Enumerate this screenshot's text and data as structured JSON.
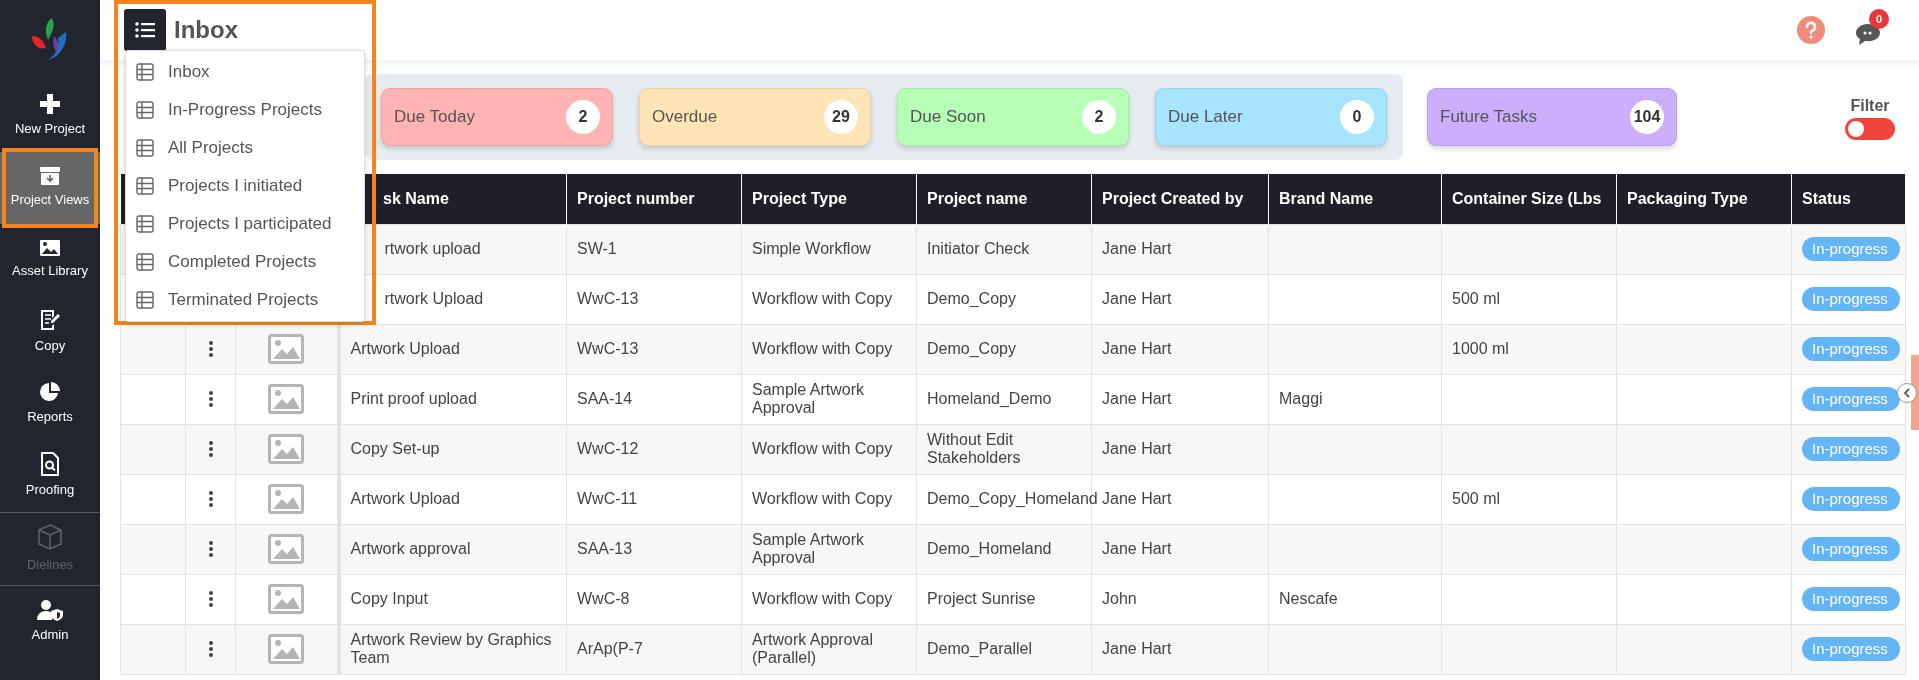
{
  "sidebar": {
    "sections": [
      {
        "items": [
          {
            "label": "New Project",
            "selected": false,
            "disabled": false,
            "highlighted": false
          },
          {
            "label": "Project Views",
            "selected": true,
            "disabled": false,
            "highlighted": true
          },
          {
            "label": "Asset Library",
            "selected": false,
            "disabled": false,
            "highlighted": false
          },
          {
            "label": "Copy",
            "selected": false,
            "disabled": false,
            "highlighted": false
          },
          {
            "label": "Reports",
            "selected": false,
            "disabled": false,
            "highlighted": false
          },
          {
            "label": "Proofing",
            "selected": false,
            "disabled": false,
            "highlighted": false
          }
        ]
      },
      {
        "items": [
          {
            "label": "Dielines",
            "selected": false,
            "disabled": true,
            "highlighted": false
          }
        ]
      },
      {
        "items": [
          {
            "label": "Admin",
            "selected": false,
            "disabled": false,
            "highlighted": false
          }
        ]
      }
    ]
  },
  "header": {
    "title": "Inbox",
    "chat_badge": "0"
  },
  "view_menu": {
    "highlighted": true,
    "items": [
      {
        "label": "Inbox"
      },
      {
        "label": "In-Progress Projects"
      },
      {
        "label": "All Projects"
      },
      {
        "label": "Projects I initiated"
      },
      {
        "label": "Projects I participated"
      },
      {
        "label": "Completed Projects"
      },
      {
        "label": "Terminated Projects"
      }
    ]
  },
  "due_cards": [
    {
      "label": "Due Today",
      "count": "2",
      "color": "#ffb3b3"
    },
    {
      "label": "Overdue",
      "count": "29",
      "color": "#ffe4b5"
    },
    {
      "label": "Due Soon",
      "count": "2",
      "color": "#b6ffb6"
    },
    {
      "label": "Due Later",
      "count": "0",
      "color": "#a6e4ff"
    }
  ],
  "future_card": {
    "label": "Future Tasks",
    "count": "104",
    "color": "#cbaefc"
  },
  "filter": {
    "label": "Filter",
    "on": false
  },
  "table": {
    "columns": [
      "sk Name",
      "Project number",
      "Project Type",
      "Project name",
      "Project Created by",
      "Brand Name",
      "Container Size (Lbs",
      "Packaging Type",
      "Status"
    ],
    "rows": [
      {
        "covered": true,
        "cells": [
          "rtwork upload",
          "SW-1",
          "Simple Workflow",
          "Initiator Check",
          "Jane Hart",
          "",
          "",
          "",
          "In-progress"
        ]
      },
      {
        "covered": true,
        "cells": [
          "rtwork Upload",
          "WwC-13",
          "Workflow with Copy",
          "Demo_Copy",
          "Jane Hart",
          "",
          "500 ml",
          "",
          "In-progress"
        ]
      },
      {
        "covered": false,
        "cells": [
          "Artwork Upload",
          "WwC-13",
          "Workflow with Copy",
          "Demo_Copy",
          "Jane Hart",
          "",
          "1000 ml",
          "",
          "In-progress"
        ]
      },
      {
        "covered": false,
        "cells": [
          "Print proof upload",
          "SAA-14",
          "Sample Artwork Approval",
          "Homeland_Demo",
          "Jane Hart",
          "Maggi",
          "",
          "",
          "In-progress"
        ]
      },
      {
        "covered": false,
        "cells": [
          "Copy Set-up",
          "WwC-12",
          "Workflow with Copy",
          "Without Edit Stakeholders",
          "Jane Hart",
          "",
          "",
          "",
          "In-progress"
        ]
      },
      {
        "covered": false,
        "cells": [
          "Artwork Upload",
          "WwC-11",
          "Workflow with Copy",
          "Demo_Copy_Homeland",
          "Jane Hart",
          "",
          "500 ml",
          "",
          "In-progress"
        ]
      },
      {
        "covered": false,
        "cells": [
          "Artwork approval",
          "SAA-13",
          "Sample Artwork Approval",
          "Demo_Homeland",
          "Jane Hart",
          "",
          "",
          "",
          "In-progress"
        ]
      },
      {
        "covered": false,
        "cells": [
          "Copy Input",
          "WwC-8",
          "Workflow with Copy",
          "Project Sunrise",
          "John",
          "Nescafe",
          "",
          "",
          "In-progress"
        ]
      },
      {
        "covered": false,
        "cells": [
          "Artwork Review by Graphics Team",
          "ArAp(P-7",
          "Artwork Approval (Parallel)",
          "Demo_Parallel",
          "Jane Hart",
          "",
          "",
          "",
          "In-progress"
        ]
      }
    ]
  }
}
